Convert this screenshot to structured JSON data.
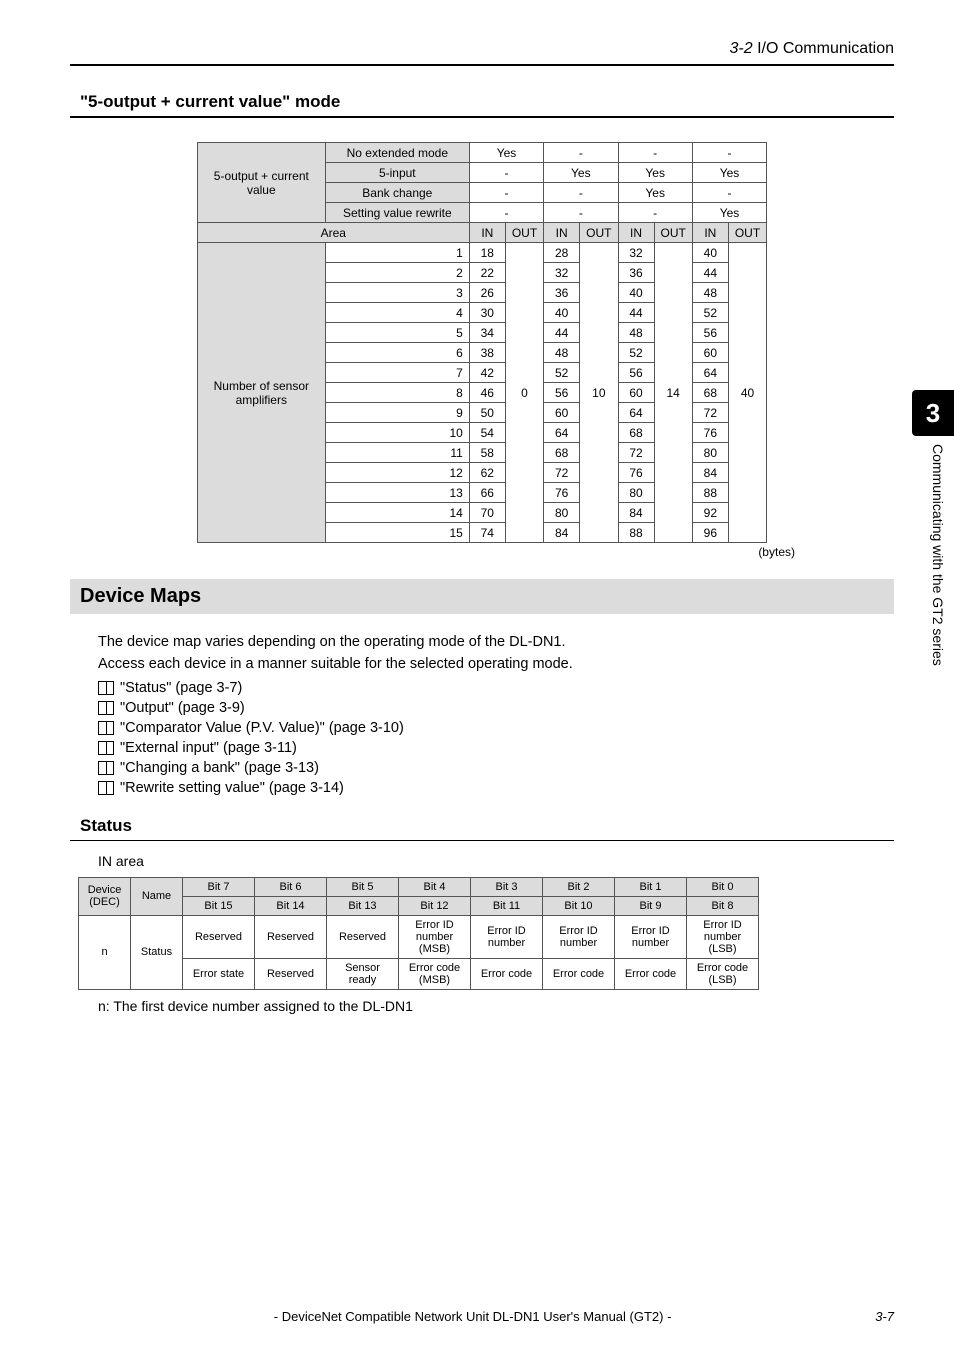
{
  "header": {
    "section": "3-2",
    "title": "I/O Communication"
  },
  "mode_heading": "\"5-output + current value\" mode",
  "mode_table": {
    "row_label": "5-output + current value",
    "opts": [
      {
        "label": "No extended mode",
        "vals": [
          "Yes",
          "-",
          "-",
          "-"
        ]
      },
      {
        "label": "5-input",
        "vals": [
          "-",
          "Yes",
          "Yes",
          "Yes"
        ]
      },
      {
        "label": "Bank change",
        "vals": [
          "-",
          "-",
          "Yes",
          "-"
        ]
      },
      {
        "label": "Setting value rewrite",
        "vals": [
          "-",
          "-",
          "-",
          "Yes"
        ]
      }
    ],
    "area_label": "Area",
    "io_headers": [
      "IN",
      "OUT",
      "IN",
      "OUT",
      "IN",
      "OUT",
      "IN",
      "OUT"
    ],
    "sensor_label": "Number of sensor amplifiers",
    "rows": [
      {
        "n": "1",
        "c1i": "18",
        "c2i": "28",
        "c3i": "32",
        "c4i": "40"
      },
      {
        "n": "2",
        "c1i": "22",
        "c2i": "32",
        "c3i": "36",
        "c4i": "44"
      },
      {
        "n": "3",
        "c1i": "26",
        "c2i": "36",
        "c3i": "40",
        "c4i": "48"
      },
      {
        "n": "4",
        "c1i": "30",
        "c2i": "40",
        "c3i": "44",
        "c4i": "52"
      },
      {
        "n": "5",
        "c1i": "34",
        "c2i": "44",
        "c3i": "48",
        "c4i": "56"
      },
      {
        "n": "6",
        "c1i": "38",
        "c2i": "48",
        "c3i": "52",
        "c4i": "60"
      },
      {
        "n": "7",
        "c1i": "42",
        "c2i": "52",
        "c3i": "56",
        "c4i": "64"
      },
      {
        "n": "8",
        "c1i": "46",
        "c2i": "56",
        "c3i": "60",
        "c4i": "68"
      },
      {
        "n": "9",
        "c1i": "50",
        "c2i": "60",
        "c3i": "64",
        "c4i": "72"
      },
      {
        "n": "10",
        "c1i": "54",
        "c2i": "64",
        "c3i": "68",
        "c4i": "76"
      },
      {
        "n": "11",
        "c1i": "58",
        "c2i": "68",
        "c3i": "72",
        "c4i": "80"
      },
      {
        "n": "12",
        "c1i": "62",
        "c2i": "72",
        "c3i": "76",
        "c4i": "84"
      },
      {
        "n": "13",
        "c1i": "66",
        "c2i": "76",
        "c3i": "80",
        "c4i": "88"
      },
      {
        "n": "14",
        "c1i": "70",
        "c2i": "80",
        "c3i": "84",
        "c4i": "92"
      },
      {
        "n": "15",
        "c1i": "74",
        "c2i": "84",
        "c3i": "88",
        "c4i": "96"
      }
    ],
    "out_vals": [
      "0",
      "10",
      "14",
      "40"
    ],
    "bytes_caption": "(bytes)"
  },
  "device_maps": {
    "heading": "Device Maps",
    "line1": "The device map varies depending on the operating mode of the DL-DN1.",
    "line2": "Access each device in a manner suitable for the selected operating mode.",
    "refs": [
      "\"Status\" (page 3-7)",
      "\"Output\" (page 3-9)",
      "\"Comparator Value (P.V. Value)\" (page 3-10)",
      "\"External input\" (page 3-11)",
      "\"Changing a bank\" (page 3-13)",
      "\"Rewrite setting value\" (page 3-14)"
    ]
  },
  "status": {
    "heading": "Status",
    "in_area": "IN area",
    "headers_top": [
      "Bit 7",
      "Bit 6",
      "Bit 5",
      "Bit 4",
      "Bit 3",
      "Bit 2",
      "Bit 1",
      "Bit 0"
    ],
    "headers_bot": [
      "Bit 15",
      "Bit 14",
      "Bit 13",
      "Bit 12",
      "Bit 11",
      "Bit 10",
      "Bit 9",
      "Bit 8"
    ],
    "device_label": "Device (DEC)",
    "name_label": "Name",
    "n": "n",
    "status_name": "Status",
    "row1": [
      "Reserved",
      "Reserved",
      "Reserved",
      "Error ID number (MSB)",
      "Error ID number",
      "Error ID number",
      "Error ID number",
      "Error ID number (LSB)"
    ],
    "row2": [
      "Error state",
      "Reserved",
      "Sensor ready",
      "Error code (MSB)",
      "Error code",
      "Error code",
      "Error code",
      "Error code (LSB)"
    ],
    "footnote": "n: The first device number assigned to the DL-DN1"
  },
  "side": {
    "chapter": "3",
    "text": "Communicating with the GT2 series"
  },
  "footer": {
    "manual": "- DeviceNet Compatible Network Unit DL-DN1 User's Manual (GT2) -",
    "page": "3-7"
  }
}
